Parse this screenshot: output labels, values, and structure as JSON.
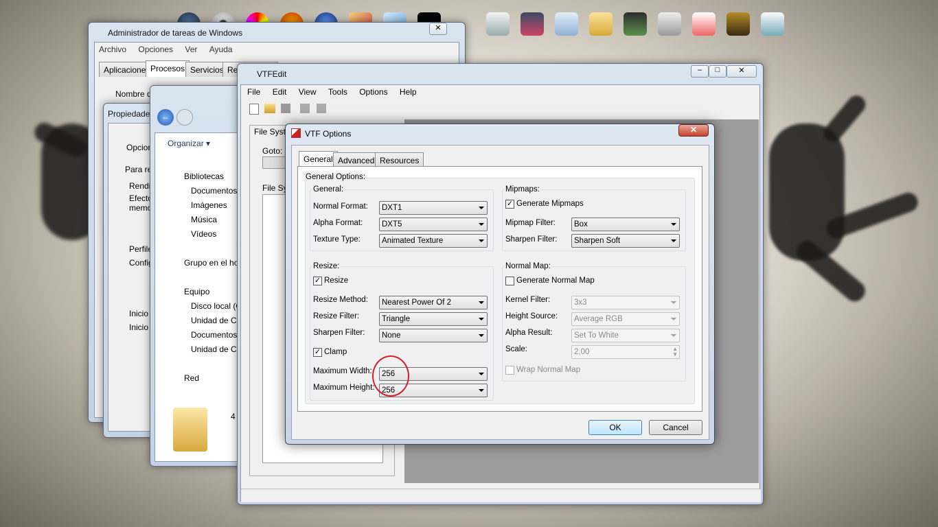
{
  "taskmgr": {
    "title": "Administrador de tareas de Windows",
    "menu": [
      "Archivo",
      "Opciones",
      "Ver",
      "Ayuda"
    ],
    "tabs": [
      "Aplicaciones",
      "Procesos",
      "Servicios",
      "Rendimiento"
    ],
    "column": "Nombre de imagen"
  },
  "props": {
    "title": "Propiedades",
    "lines": [
      "Opcion",
      "Para re",
      "Rendi",
      "Efecto",
      "memor",
      "Perfile",
      "Config",
      "Inicio y",
      "Inicio"
    ]
  },
  "explorer": {
    "organize": "Organizar",
    "tree": [
      "Bibliotecas",
      "Documentos",
      "Imágenes",
      "Música",
      "Vídeos",
      "Grupo en el ho",
      "Equipo",
      "Disco local (C",
      "Unidad de CD",
      "Documentos",
      "Unidad de CD",
      "Red"
    ]
  },
  "vtfedit": {
    "title": "VTFEdit",
    "menu": [
      "File",
      "Edit",
      "View",
      "Tools",
      "Options",
      "Help"
    ],
    "panel_label": "File System",
    "goto": "Goto:",
    "file_sys": "File Sys"
  },
  "dialog": {
    "title": "VTF Options",
    "tabs": [
      "General",
      "Advanced",
      "Resources"
    ],
    "general_options": "General Options:",
    "general": {
      "label": "General:",
      "normal_format_label": "Normal Format:",
      "normal_format": "DXT1",
      "alpha_format_label": "Alpha Format:",
      "alpha_format": "DXT5",
      "texture_type_label": "Texture Type:",
      "texture_type": "Animated Texture"
    },
    "mipmaps": {
      "label": "Mipmaps:",
      "generate": "Generate Mipmaps",
      "filter_label": "Mipmap Filter:",
      "filter": "Box",
      "sharpen_label": "Sharpen Filter:",
      "sharpen": "Sharpen Soft"
    },
    "resize": {
      "label": "Resize:",
      "resize": "Resize",
      "method_label": "Resize Method:",
      "method": "Nearest Power Of 2",
      "filter_label": "Resize Filter:",
      "filter": "Triangle",
      "sharpen_label": "Sharpen Filter:",
      "sharpen": "None",
      "clamp": "Clamp",
      "max_width_label": "Maximum Width:",
      "max_width": "256",
      "max_height_label": "Maximum Height:",
      "max_height": "256"
    },
    "normal_map": {
      "label": "Normal Map:",
      "generate": "Generate Normal Map",
      "kernel_label": "Kernel Filter:",
      "kernel": "3x3",
      "height_label": "Height Source:",
      "height": "Average RGB",
      "alpha_label": "Alpha Result:",
      "alpha": "Set To White",
      "scale_label": "Scale:",
      "scale": "2,00",
      "wrap": "Wrap Normal Map"
    },
    "ok": "OK",
    "cancel": "Cancel",
    "close": "✕"
  },
  "explorer_status": "4",
  "colors": {
    "highlight_circle": "#d0202a",
    "accent": "#3c7fb1"
  }
}
